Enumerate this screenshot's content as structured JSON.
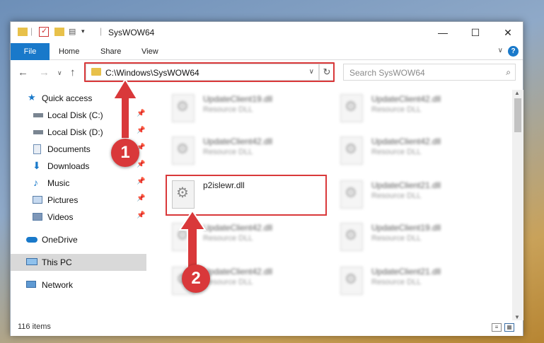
{
  "window": {
    "title": "SysWOW64"
  },
  "ribbon": {
    "tabs": [
      "File",
      "Home",
      "Share",
      "View"
    ],
    "help_label": "?"
  },
  "nav": {
    "address": "C:\\Windows\\SysWOW64",
    "search_placeholder": "Search SysWOW64"
  },
  "sidebar": {
    "items": [
      {
        "label": "Quick access",
        "icon": "star-icon",
        "pinned": false
      },
      {
        "label": "Local Disk (C:)",
        "icon": "drive-icon",
        "pinned": true
      },
      {
        "label": "Local Disk (D:)",
        "icon": "drive-icon",
        "pinned": true
      },
      {
        "label": "Documents",
        "icon": "documents-icon",
        "pinned": true
      },
      {
        "label": "Downloads",
        "icon": "download-arrow-icon",
        "pinned": true
      },
      {
        "label": "Music",
        "icon": "music-note-icon",
        "pinned": true
      },
      {
        "label": "Pictures",
        "icon": "pictures-icon",
        "pinned": true
      },
      {
        "label": "Videos",
        "icon": "videos-icon",
        "pinned": true
      },
      {
        "label": "OneDrive",
        "icon": "cloud-icon",
        "pinned": false
      },
      {
        "label": "This PC",
        "icon": "monitor-icon",
        "pinned": false,
        "selected": true
      },
      {
        "label": "Network",
        "icon": "network-icon",
        "pinned": false
      }
    ]
  },
  "files": [
    {
      "name": "UpdateClient19.dll",
      "type": "Resource DLL",
      "blurred": true
    },
    {
      "name": "UpdateClient42.dll",
      "type": "Resource DLL",
      "blurred": true
    },
    {
      "name": "UpdateClient42.dll",
      "type": "Resource DLL",
      "blurred": true
    },
    {
      "name": "UpdateClient42.dll",
      "type": "Resource DLL",
      "blurred": true
    },
    {
      "name": "p2islewr.dll",
      "type": "",
      "blurred": false,
      "highlighted": true
    },
    {
      "name": "UpdateClient21.dll",
      "type": "Resource DLL",
      "blurred": true
    },
    {
      "name": "UpdateClient42.dll",
      "type": "Resource DLL",
      "blurred": true
    },
    {
      "name": "UpdateClient19.dll",
      "type": "Resource DLL",
      "blurred": true
    },
    {
      "name": "UpdateClient42.dll",
      "type": "Resource DLL",
      "blurred": true
    },
    {
      "name": "UpdateClient21.dll",
      "type": "Resource DLL",
      "blurred": true
    }
  ],
  "status": {
    "item_count": "116 items"
  },
  "annotations": {
    "step1": "1",
    "step2": "2",
    "color": "#d9383a"
  }
}
